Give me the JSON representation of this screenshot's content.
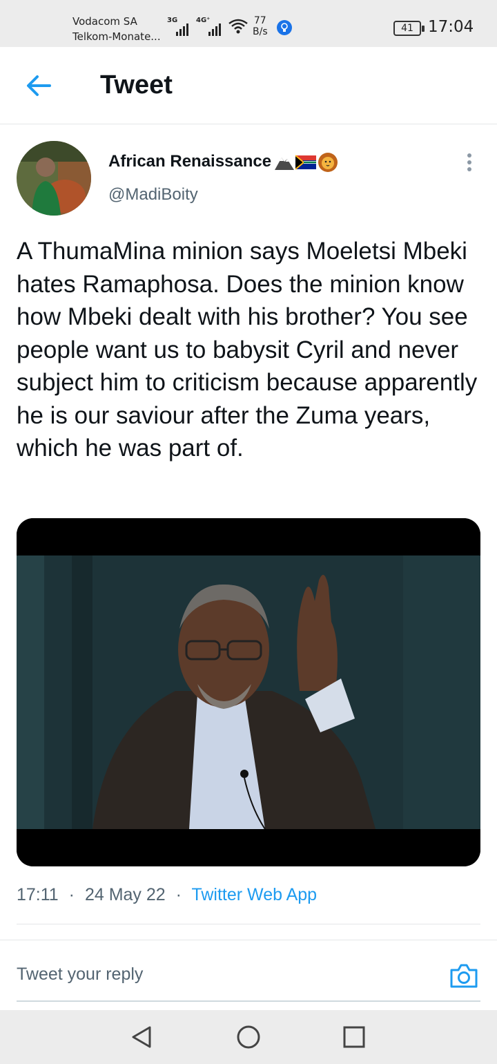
{
  "status_bar": {
    "carrier_1": "Vodacom SA",
    "carrier_2": "Telkom-Monate...",
    "signal_1_tag": "3G",
    "signal_2_tag": "4G⁺",
    "speed_value": "77",
    "speed_unit": "B/s",
    "battery": "41",
    "time": "17:04"
  },
  "header": {
    "title": "Tweet",
    "back_icon": "arrow-left-icon",
    "accent_color": "#1d9bf0"
  },
  "tweet": {
    "author_name": "African Renaissance",
    "author_emojis": [
      "🏔",
      "🇿🇦",
      "🦁"
    ],
    "handle": "@MadiBoity",
    "text": "A ThumaMina minion says Moeletsi Mbeki hates Ramaphosa. Does the minion know how Mbeki dealt with his brother? You see people want us to babysit Cyril and never subject him to criticism because apparently he is our saviour after the Zuma years, which he was part of.",
    "time": "17:11",
    "date": "24 May 22",
    "source": "Twitter Web App",
    "separator": "·"
  },
  "reply": {
    "placeholder": "Tweet your reply",
    "camera_icon": "camera-icon"
  },
  "nav": {
    "back_icon": "triangle-back-icon",
    "home_icon": "circle-home-icon",
    "recents_icon": "square-recents-icon"
  }
}
